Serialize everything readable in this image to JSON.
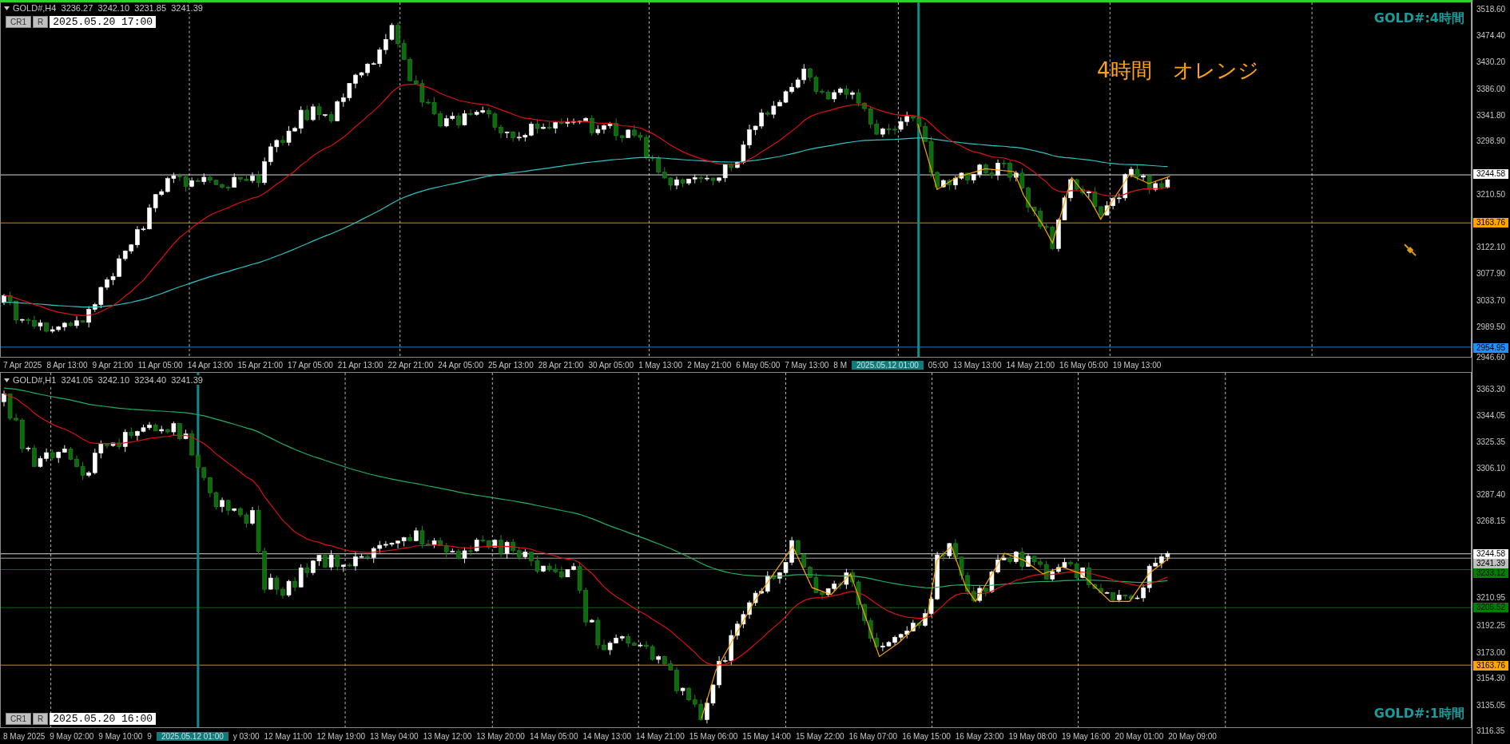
{
  "panels": [
    {
      "symbol": "GOLD#,H4",
      "ohlc": [
        "3236.27",
        "3242.10",
        "3231.85",
        "3241.39"
      ],
      "buttons": [
        {
          "label": "CR1"
        },
        {
          "label": "R"
        }
      ],
      "datetime": "2025.05.20 17:00",
      "chart_label": "GOLD#:4時間",
      "annotation": "4時間　オレンジ",
      "price_axis": [
        "3518.60",
        "3474.40",
        "3430.20",
        "3386.00",
        "3341.80",
        "3298.90",
        "3210.50",
        "3122.10",
        "3077.90",
        "3033.70",
        "2989.50",
        "2946.60"
      ],
      "price_tags": [
        {
          "value": "3244.58",
          "color": "#ffffff"
        },
        {
          "value": "3163.76",
          "color": "#ffa500"
        },
        {
          "value": "2954.95",
          "color": "#1e90ff"
        }
      ],
      "time_axis": [
        {
          "label": "7 Apr 2025",
          "kind": "tick"
        },
        {
          "label": "8 Apr 13:00",
          "kind": "tick"
        },
        {
          "label": "9 Apr 21:00",
          "kind": "tick"
        },
        {
          "label": "11 Apr 05:00",
          "kind": "tick"
        },
        {
          "label": "14 Apr 13:00",
          "kind": "tick"
        },
        {
          "label": "15 Apr 21:00",
          "kind": "tick"
        },
        {
          "label": "17 Apr 05:00",
          "kind": "tick"
        },
        {
          "label": "21 Apr 13:00",
          "kind": "tick"
        },
        {
          "label": "22 Apr 21:00",
          "kind": "tick"
        },
        {
          "label": "24 Apr 05:00",
          "kind": "tick"
        },
        {
          "label": "25 Apr 13:00",
          "kind": "tick"
        },
        {
          "label": "28 Apr 21:00",
          "kind": "tick"
        },
        {
          "label": "30 Apr 05:00",
          "kind": "tick"
        },
        {
          "label": "1 May 13:00",
          "kind": "tick"
        },
        {
          "label": "2 May 21:00",
          "kind": "tick"
        },
        {
          "label": "6 May 05:00",
          "kind": "tick"
        },
        {
          "label": "7 May 13:00",
          "kind": "tick"
        },
        {
          "label": "8 M",
          "kind": "tick"
        },
        {
          "label": "2025.05.12 01:00",
          "kind": "cursor"
        },
        {
          "label": "05:00",
          "kind": "tick"
        },
        {
          "label": "13 May 13:00",
          "kind": "tick"
        },
        {
          "label": "14 May 21:00",
          "kind": "tick"
        },
        {
          "label": "16 May 05:00",
          "kind": "tick"
        },
        {
          "label": "19 May 13:00",
          "kind": "tick"
        }
      ]
    },
    {
      "symbol": "GOLD#,H1",
      "ohlc": [
        "3241.05",
        "3242.10",
        "3234.40",
        "3241.39"
      ],
      "buttons": [
        {
          "label": "CR1"
        },
        {
          "label": "R"
        }
      ],
      "datetime": "2025.05.20 16:00",
      "chart_label": "GOLD#:1時間",
      "price_axis": [
        "3363.30",
        "3344.05",
        "3325.35",
        "3306.10",
        "3287.40",
        "3268.15",
        "3210.95",
        "3192.25",
        "3173.00",
        "3154.30",
        "3135.05",
        "3116.35"
      ],
      "price_tags": [
        {
          "value": "3244.58",
          "color": "#ffffff"
        },
        {
          "value": "3241.39",
          "color": "#c0c0c0"
        },
        {
          "value": "3233.12",
          "color": "#008000"
        },
        {
          "value": "3205.52",
          "color": "#008000"
        },
        {
          "value": "3163.76",
          "color": "#ffa500"
        }
      ],
      "time_axis": [
        {
          "label": "8 May 2025",
          "kind": "tick"
        },
        {
          "label": "9 May 02:00",
          "kind": "tick"
        },
        {
          "label": "9 May 10:00",
          "kind": "tick"
        },
        {
          "label": "9",
          "kind": "tick"
        },
        {
          "label": "2025.05.12 01:00",
          "kind": "cursor"
        },
        {
          "label": "y 03:00",
          "kind": "tick"
        },
        {
          "label": "12 May 11:00",
          "kind": "tick"
        },
        {
          "label": "12 May 19:00",
          "kind": "tick"
        },
        {
          "label": "13 May 04:00",
          "kind": "tick"
        },
        {
          "label": "13 May 12:00",
          "kind": "tick"
        },
        {
          "label": "13 May 20:00",
          "kind": "tick"
        },
        {
          "label": "14 May 05:00",
          "kind": "tick"
        },
        {
          "label": "14 May 13:00",
          "kind": "tick"
        },
        {
          "label": "14 May 21:00",
          "kind": "tick"
        },
        {
          "label": "15 May 06:00",
          "kind": "tick"
        },
        {
          "label": "15 May 14:00",
          "kind": "tick"
        },
        {
          "label": "15 May 22:00",
          "kind": "tick"
        },
        {
          "label": "16 May 07:00",
          "kind": "tick"
        },
        {
          "label": "16 May 15:00",
          "kind": "tick"
        },
        {
          "label": "16 May 23:00",
          "kind": "tick"
        },
        {
          "label": "19 May 08:00",
          "kind": "tick"
        },
        {
          "label": "19 May 16:00",
          "kind": "tick"
        },
        {
          "label": "20 May 01:00",
          "kind": "tick"
        },
        {
          "label": "20 May 09:00",
          "kind": "tick"
        }
      ]
    }
  ]
}
